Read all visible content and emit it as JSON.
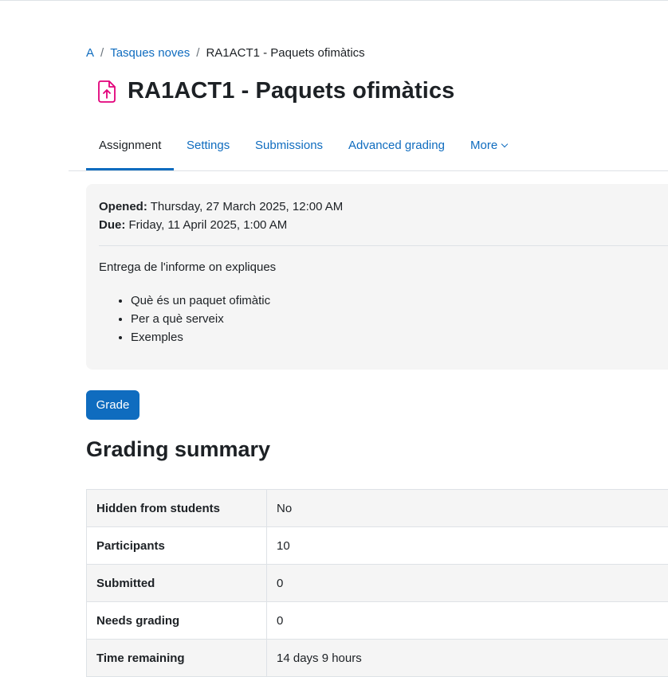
{
  "breadcrumb": {
    "items": [
      {
        "label": "A"
      },
      {
        "label": "Tasques noves"
      }
    ],
    "separator": "/",
    "current": "RA1ACT1 - Paquets ofimàtics"
  },
  "page": {
    "title": "RA1ACT1 - Paquets ofimàtics",
    "icon": "assignment-upload-icon",
    "icon_color": "#e2007a"
  },
  "tabs": [
    {
      "label": "Assignment",
      "active": true
    },
    {
      "label": "Settings"
    },
    {
      "label": "Submissions"
    },
    {
      "label": "Advanced grading"
    },
    {
      "label": "More"
    }
  ],
  "activity": {
    "opened_label": "Opened:",
    "opened_value": "Thursday, 27 March 2025, 12:00 AM",
    "due_label": "Due:",
    "due_value": "Friday, 11 April 2025, 1:00 AM",
    "intro": "Entrega de l'informe on expliques",
    "bullets": [
      "Què és un paquet ofimàtic",
      "Per a què serveix",
      "Exemples"
    ]
  },
  "grade_button": "Grade",
  "summary": {
    "title": "Grading summary",
    "rows": [
      {
        "label": "Hidden from students",
        "value": "No"
      },
      {
        "label": "Participants",
        "value": "10"
      },
      {
        "label": "Submitted",
        "value": "0"
      },
      {
        "label": "Needs grading",
        "value": "0"
      },
      {
        "label": "Time remaining",
        "value": "14 days 9 hours"
      }
    ]
  },
  "colors": {
    "primary": "#0f6cbf",
    "text": "#1d2125",
    "box_bg": "#f5f5f5",
    "border": "#dee2e6"
  }
}
